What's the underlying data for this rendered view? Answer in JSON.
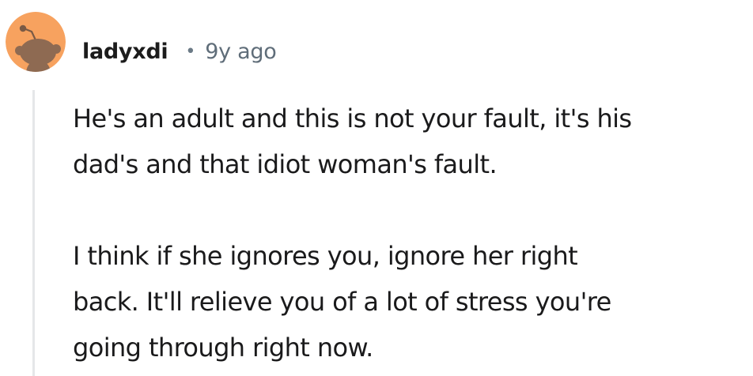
{
  "comment": {
    "username": "ladyxdi",
    "separator": "•",
    "timestamp": "9y ago",
    "avatar_icon": "snoo-avatar-icon",
    "avatar_bg": "#f7a25f",
    "paragraphs": [
      {
        "lines": [
          "He's an adult and this is not your fault, it's his",
          "dad's and that idiot woman's fault."
        ]
      },
      {
        "lines": [
          "I think if she ignores you, ignore her right",
          "back. It'll relieve you of a lot of stress you're",
          "going through right now."
        ]
      }
    ]
  }
}
